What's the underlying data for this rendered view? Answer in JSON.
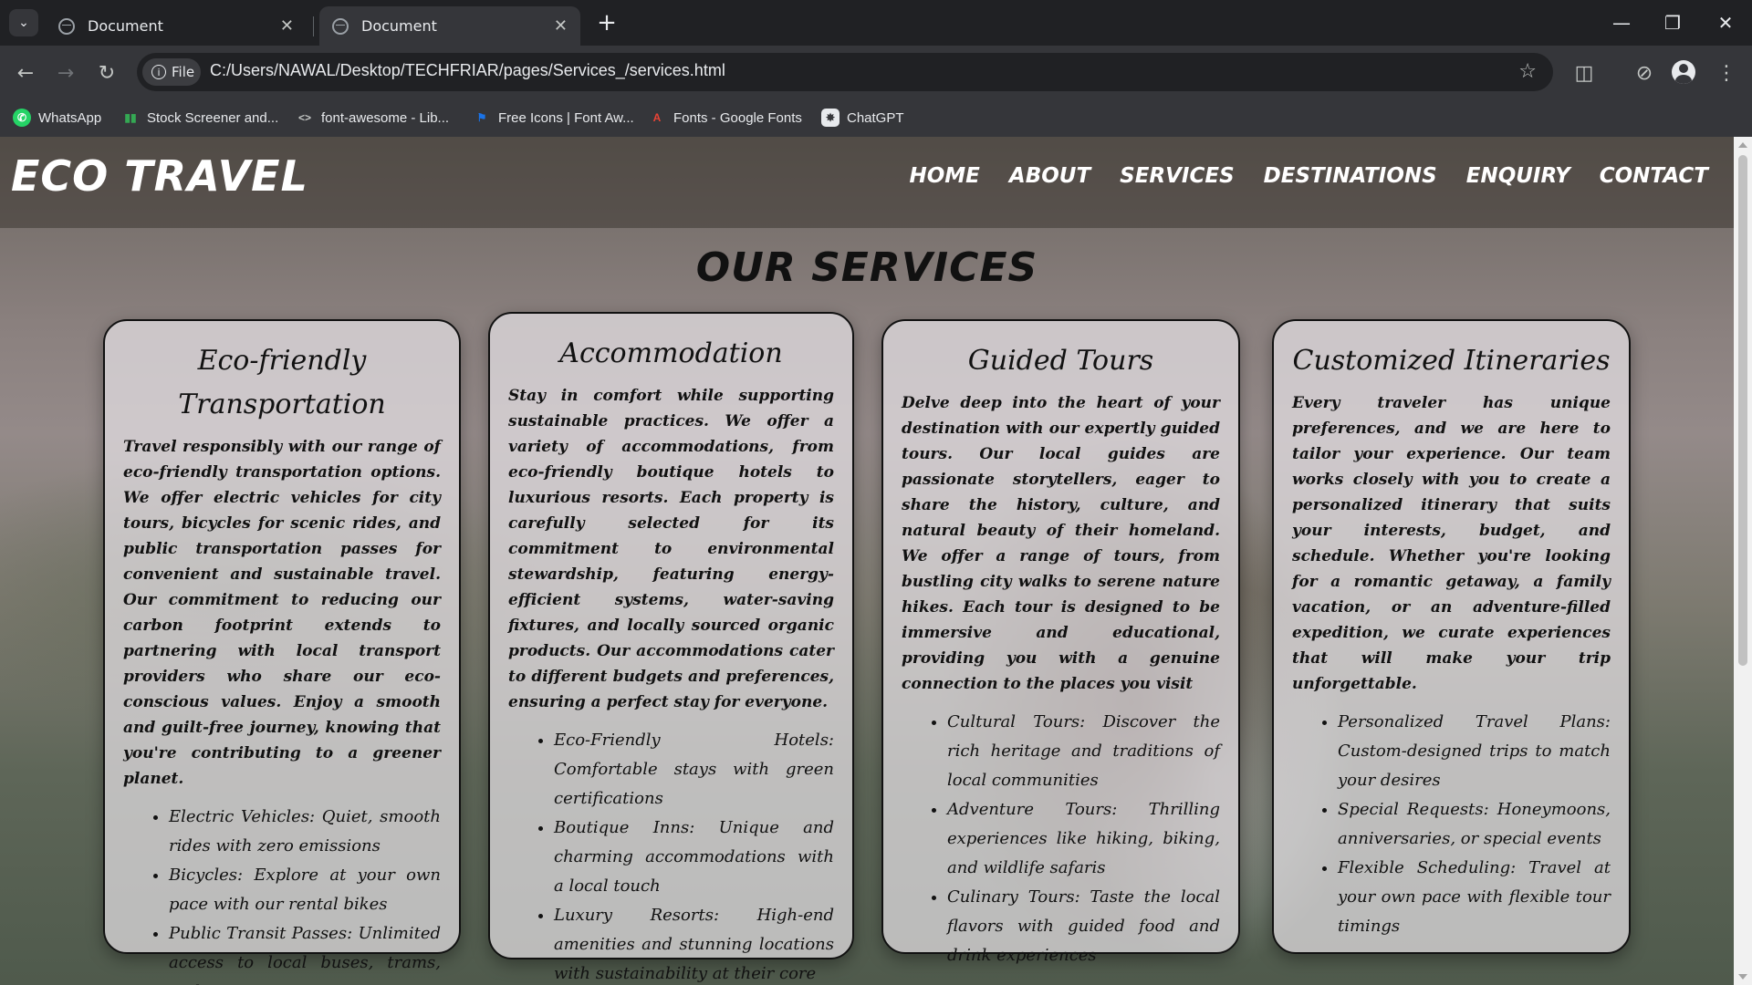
{
  "browser": {
    "tabs": [
      {
        "title": "Document",
        "active": false
      },
      {
        "title": "Document",
        "active": true
      }
    ],
    "site_chip": "File",
    "url": "C:/Users/NAWAL/Desktop/TECHFRIAR/pages/Services_/services.html",
    "bookmarks": [
      {
        "label": "WhatsApp",
        "icon": "whatsapp-icon",
        "color": "#25d366"
      },
      {
        "label": "Stock Screener and...",
        "icon": "bar-chart-icon",
        "color": "#34a853"
      },
      {
        "label": "font-awesome - Lib...",
        "icon": "code-icon",
        "color": "#c4c7c5"
      },
      {
        "label": "Free Icons | Font Aw...",
        "icon": "flag-icon",
        "color": "#1a73e8"
      },
      {
        "label": "Fonts - Google Fonts",
        "icon": "google-fonts-icon",
        "color": "#ea4335"
      },
      {
        "label": "ChatGPT",
        "icon": "chatgpt-icon",
        "color": "#e8eaed"
      }
    ]
  },
  "site": {
    "logo": "ECO TRAVEL",
    "nav": [
      "HOME",
      "ABOUT",
      "SERVICES",
      "DESTINATIONS",
      "ENQUIRY",
      "CONTACT"
    ],
    "page_title": "OUR SERVICES",
    "cards": [
      {
        "title": "Eco-friendly Transportation",
        "description": "Travel responsibly with our range of eco-friendly transportation options. We offer electric vehicles for city tours, bicycles for scenic rides, and public transportation passes for convenient and sustainable travel. Our commitment to reducing our carbon footprint extends to partnering with local transport providers who share our eco-conscious values. Enjoy a smooth and guilt-free journey, knowing that you're contributing to a greener planet.",
        "items": [
          "Electric Vehicles: Quiet, smooth rides with zero emissions",
          "Bicycles: Explore at your own pace with our rental bikes",
          "Public Transit Passes: Unlimited access to local buses, trams, and trains"
        ]
      },
      {
        "title": "Accommodation",
        "description": "Stay in comfort while supporting sustainable practices. We offer a variety of accommodations, from eco-friendly boutique hotels to luxurious resorts. Each property is carefully selected for its commitment to environmental stewardship, featuring energy-efficient systems, water-saving fixtures, and locally sourced organic products. Our accommodations cater to different budgets and preferences, ensuring a perfect stay for everyone.",
        "items": [
          "Eco-Friendly Hotels: Comfortable stays with green certifications",
          "Boutique Inns: Unique and charming accommodations with a local touch",
          "Luxury Resorts: High-end amenities and stunning locations with sustainability at their core"
        ]
      },
      {
        "title": "Guided Tours",
        "description": "Delve deep into the heart of your destination with our expertly guided tours. Our local guides are passionate storytellers, eager to share the history, culture, and natural beauty of their homeland. We offer a range of tours, from bustling city walks to serene nature hikes. Each tour is designed to be immersive and educational, providing you with a genuine connection to the places you visit",
        "items": [
          "Cultural Tours: Discover the rich heritage and traditions of local communities",
          "Adventure Tours: Thrilling experiences like hiking, biking, and wildlife safaris",
          "Culinary Tours: Taste the local flavors with guided food and drink experiences"
        ]
      },
      {
        "title": "Customized Itineraries",
        "description": "Every traveler has unique preferences, and we are here to tailor your experience. Our team works closely with you to create a personalized itinerary that suits your interests, budget, and schedule. Whether you're looking for a romantic getaway, a family vacation, or an adventure-filled expedition, we curate experiences that will make your trip unforgettable.",
        "items": [
          "Personalized Travel Plans: Custom-designed trips to match your desires",
          "Special Requests: Honeymoons, anniversaries, or special events",
          "Flexible Scheduling: Travel at your own pace with flexible tour timings"
        ]
      }
    ]
  }
}
